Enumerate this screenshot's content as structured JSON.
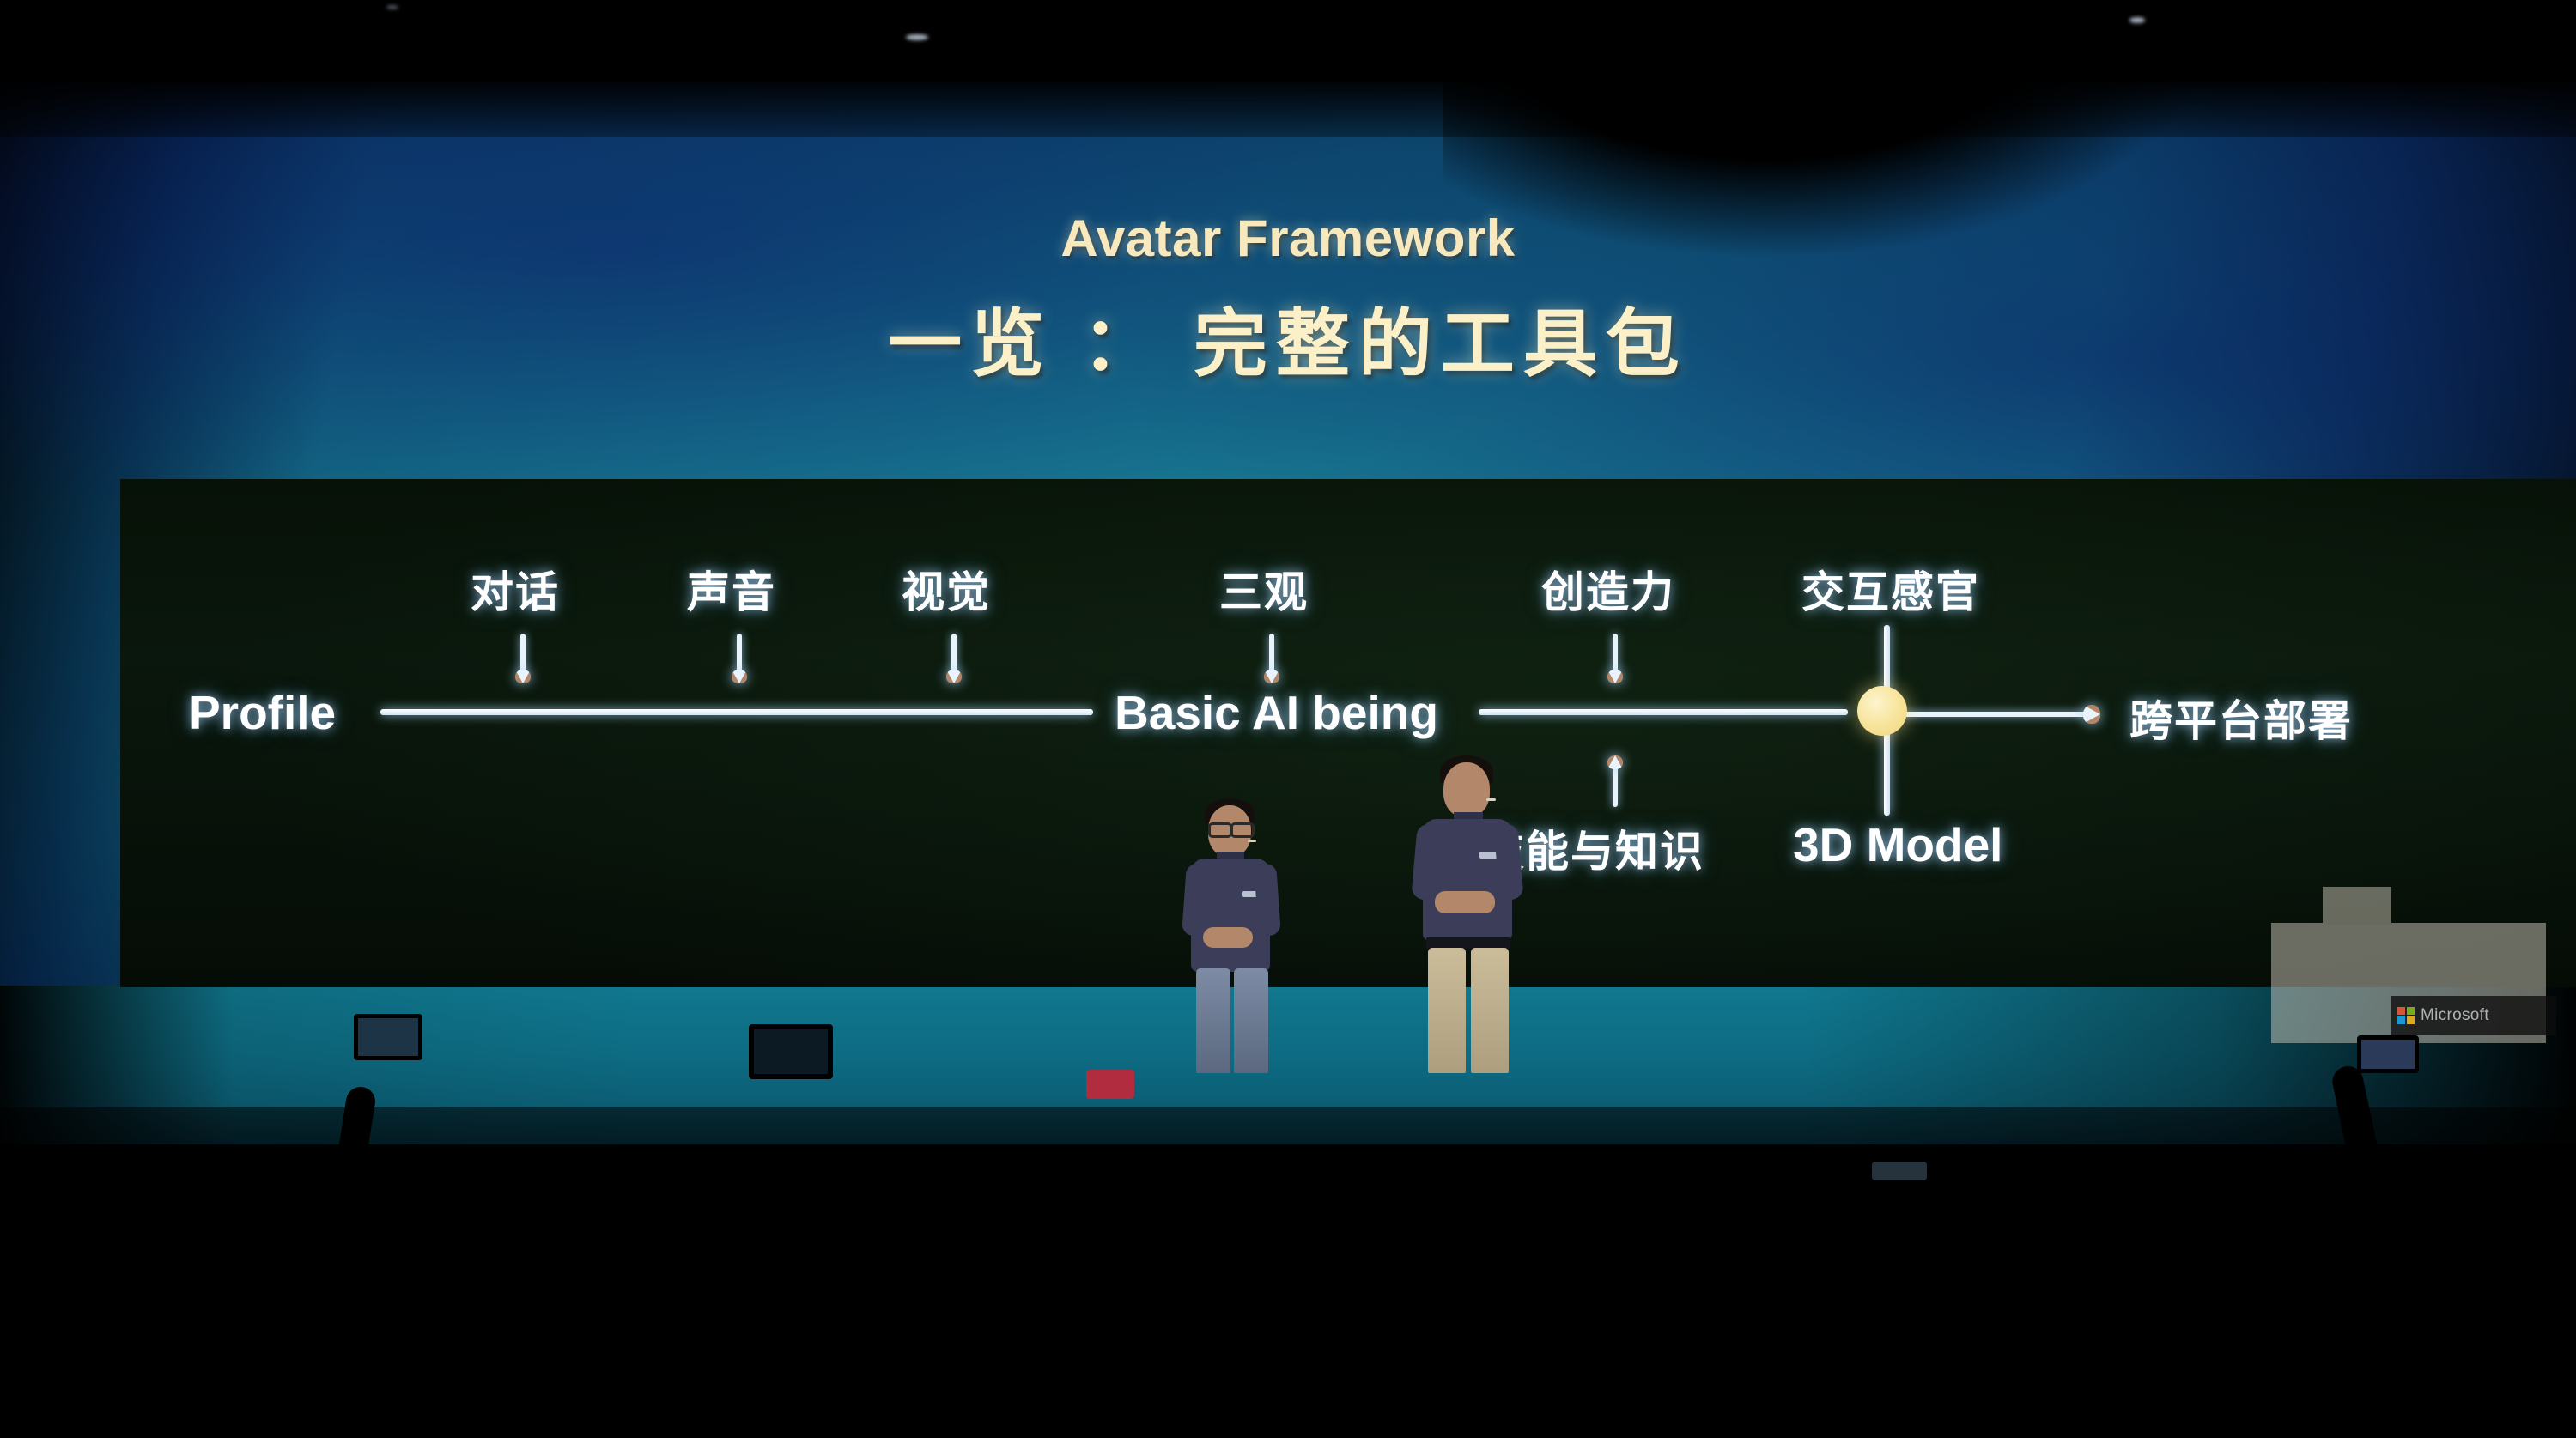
{
  "slide": {
    "kicker": "Avatar Framework",
    "heading": "一览 ： 完整的工具包",
    "title_color": "#f7e9bd",
    "screen_color": "#15708a",
    "panel_color": "#0a170c"
  },
  "diagram": {
    "start_label": "Profile",
    "center_label": "Basic AI being",
    "end_label": "跨平台部署",
    "node_label": "3D Model",
    "node_color": "#f7e398",
    "line_color": "#e9f3fb",
    "top_inputs": [
      {
        "label": "对话"
      },
      {
        "label": "声音"
      },
      {
        "label": "视觉"
      },
      {
        "label": "三观"
      },
      {
        "label": "创造力"
      },
      {
        "label": "交互感官"
      }
    ],
    "bottom_inputs": [
      {
        "label": "技能与知识"
      }
    ]
  },
  "branding": {
    "name": "Microsoft",
    "logo_colors": [
      "#f25022",
      "#7fba00",
      "#00a4ef",
      "#ffb900"
    ]
  }
}
